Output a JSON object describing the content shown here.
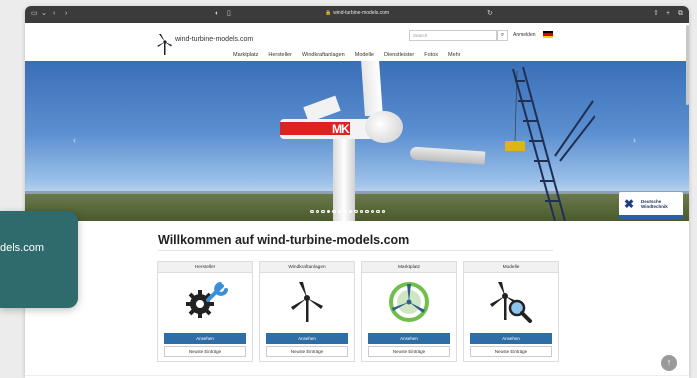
{
  "browser": {
    "url": "wind-turbine-models.com"
  },
  "header": {
    "logo_text": "wind-turbine-models.com",
    "search_placeholder": "Search",
    "login_label": "Anmelden",
    "nav": [
      "Marktplatz",
      "Hersteller",
      "Windkraftanlagen",
      "Modelle",
      "Dienstleister",
      "Fotos",
      "Mehr"
    ]
  },
  "hero": {
    "turbine_brand": "MK",
    "sponsor_line1": "Deutsche",
    "sponsor_line2": "Windtechnik",
    "slide_count": 14,
    "active_slide": 3
  },
  "main": {
    "welcome_title": "Willkommen auf wind-turbine-models.com",
    "cards": [
      {
        "title": "Hersteller",
        "icon": "gear-wrench-icon",
        "button": "Ansehen",
        "link": "Neuste Einträge"
      },
      {
        "title": "Windkraftanlagen",
        "icon": "wind-turbine-icon",
        "button": "Ansehen",
        "link": "Neuste Einträge"
      },
      {
        "title": "Marktplatz",
        "icon": "marketplace-turbine-icon",
        "button": "Ansehen",
        "link": "Neuste Einträge"
      },
      {
        "title": "Modelle",
        "icon": "turbine-search-icon",
        "button": "Ansehen",
        "link": "Neuste Einträge"
      }
    ]
  },
  "overlay": {
    "text": "dels.com"
  },
  "colors": {
    "primary_button": "#2f6da6",
    "overlay_bg": "#2f6b6c",
    "icon_blue": "#3b8fd6",
    "icon_green": "#6fbf4a"
  }
}
